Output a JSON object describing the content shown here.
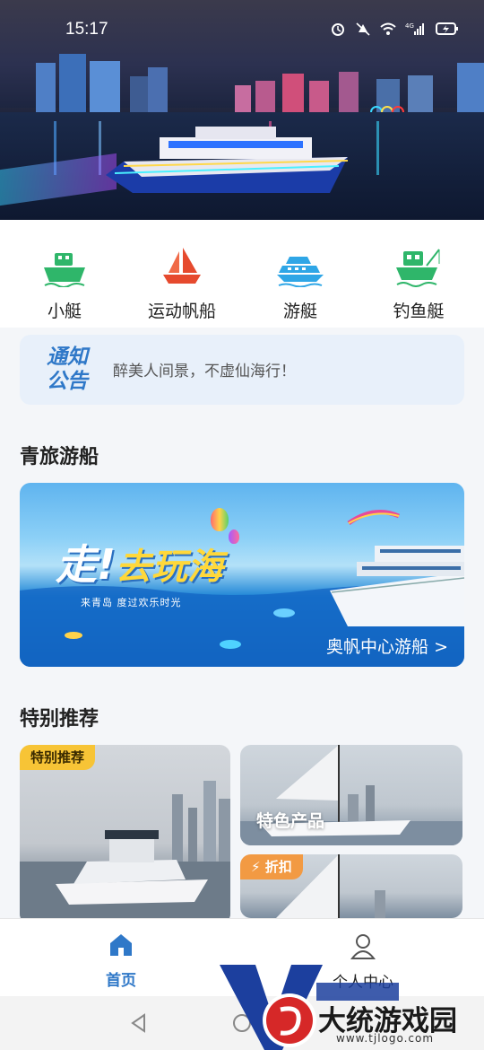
{
  "status": {
    "time": "15:17",
    "network": "4G"
  },
  "categories": [
    {
      "label": "小艇",
      "icon": "boat-icon",
      "color": "#2fb66a"
    },
    {
      "label": "运动帆船",
      "icon": "sailboat-icon",
      "color": "#e64a2e"
    },
    {
      "label": "游艇",
      "icon": "yacht-icon",
      "color": "#2fa6e6"
    },
    {
      "label": "钓鱼艇",
      "icon": "fishing-boat-icon",
      "color": "#2fb66a"
    }
  ],
  "notice": {
    "badge_line1": "通知",
    "badge_line2": "公告",
    "text": "醉美人间景，不虚仙海行！"
  },
  "section_cruise": {
    "title": "青旅游船"
  },
  "banner": {
    "title_part1": "走",
    "title_part2": "去",
    "title_part3": "玩海",
    "subtitle": "来青岛  度过欢乐时光",
    "link": "奥帆中心游船 >"
  },
  "section_recommend": {
    "title": "特别推荐"
  },
  "recommend": {
    "big_tag": "特别推荐",
    "small1_label": "特色产品",
    "small2_tag": "⚡ 折扣"
  },
  "nav": {
    "home": "首页",
    "profile": "个人中心"
  },
  "watermark": {
    "text": "大统游戏园",
    "url": "www.tjlogo.com"
  },
  "colors": {
    "accent": "#2f78c8",
    "nav_active": "#2f78c8",
    "tag_yellow": "#f7c436",
    "tag_orange": "#f29a43"
  }
}
